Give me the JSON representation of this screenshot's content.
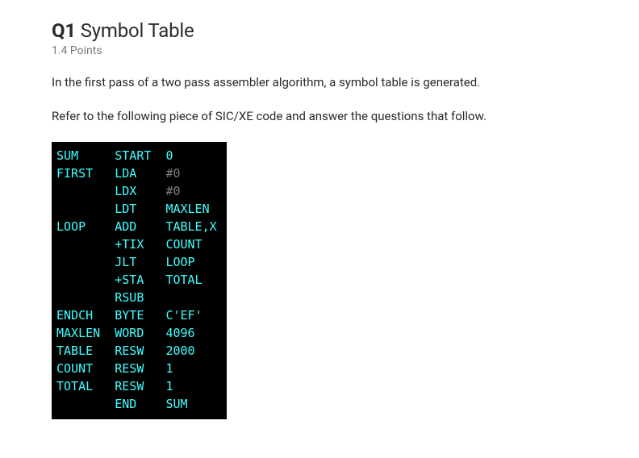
{
  "question": {
    "number": "Q1",
    "title": "Symbol Table",
    "points": "1.4 Points"
  },
  "paragraphs": [
    "In the first pass of a two pass assembler algorithm, a symbol table is generated.",
    "Refer to the following piece of SIC/XE code and answer the questions that follow."
  ],
  "code": [
    {
      "label": "SUM",
      "opcode": "START",
      "operand": "0",
      "dim": false
    },
    {
      "label": "FIRST",
      "opcode": "LDA",
      "operand": "#0",
      "dim": true
    },
    {
      "label": "",
      "opcode": "LDX",
      "operand": "#0",
      "dim": true
    },
    {
      "label": "",
      "opcode": "LDT",
      "operand": "MAXLEN",
      "dim": false
    },
    {
      "label": "LOOP",
      "opcode": "ADD",
      "operand": "TABLE,X",
      "dim": false
    },
    {
      "label": "",
      "opcode": "+TIX",
      "operand": "COUNT",
      "dim": false
    },
    {
      "label": "",
      "opcode": "JLT",
      "operand": "LOOP",
      "dim": false
    },
    {
      "label": "",
      "opcode": "+STA",
      "operand": "TOTAL",
      "dim": false
    },
    {
      "label": "",
      "opcode": "RSUB",
      "operand": "",
      "dim": false
    },
    {
      "label": "ENDCH",
      "opcode": "BYTE",
      "operand": "C'EF'",
      "dim": false
    },
    {
      "label": "MAXLEN",
      "opcode": "WORD",
      "operand": "4096",
      "dim": false
    },
    {
      "label": "TABLE",
      "opcode": "RESW",
      "operand": "2000",
      "dim": false
    },
    {
      "label": "COUNT",
      "opcode": "RESW",
      "operand": "1",
      "dim": false
    },
    {
      "label": "TOTAL",
      "opcode": "RESW",
      "operand": "1",
      "dim": false
    },
    {
      "label": "",
      "opcode": "END",
      "operand": "SUM",
      "dim": false
    }
  ]
}
